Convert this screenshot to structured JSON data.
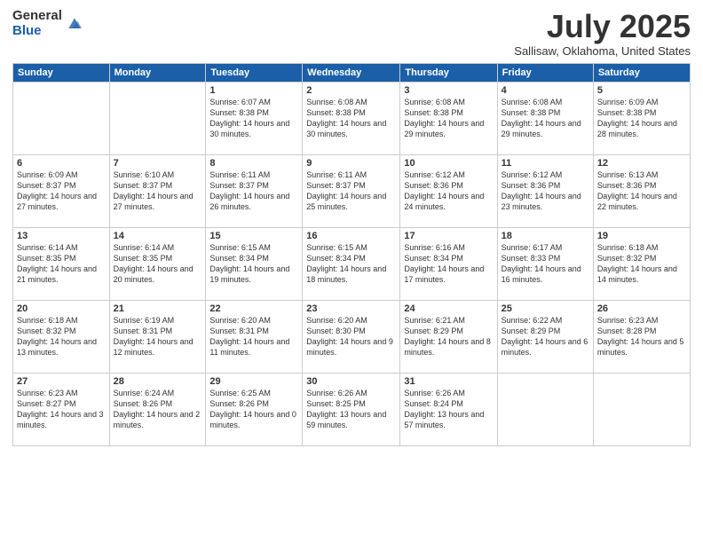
{
  "logo": {
    "general": "General",
    "blue": "Blue"
  },
  "title": "July 2025",
  "location": "Sallisaw, Oklahoma, United States",
  "headers": [
    "Sunday",
    "Monday",
    "Tuesday",
    "Wednesday",
    "Thursday",
    "Friday",
    "Saturday"
  ],
  "weeks": [
    [
      {
        "day": "",
        "sunrise": "",
        "sunset": "",
        "daylight": ""
      },
      {
        "day": "",
        "sunrise": "",
        "sunset": "",
        "daylight": ""
      },
      {
        "day": "1",
        "sunrise": "Sunrise: 6:07 AM",
        "sunset": "Sunset: 8:38 PM",
        "daylight": "Daylight: 14 hours and 30 minutes."
      },
      {
        "day": "2",
        "sunrise": "Sunrise: 6:08 AM",
        "sunset": "Sunset: 8:38 PM",
        "daylight": "Daylight: 14 hours and 30 minutes."
      },
      {
        "day": "3",
        "sunrise": "Sunrise: 6:08 AM",
        "sunset": "Sunset: 8:38 PM",
        "daylight": "Daylight: 14 hours and 29 minutes."
      },
      {
        "day": "4",
        "sunrise": "Sunrise: 6:08 AM",
        "sunset": "Sunset: 8:38 PM",
        "daylight": "Daylight: 14 hours and 29 minutes."
      },
      {
        "day": "5",
        "sunrise": "Sunrise: 6:09 AM",
        "sunset": "Sunset: 8:38 PM",
        "daylight": "Daylight: 14 hours and 28 minutes."
      }
    ],
    [
      {
        "day": "6",
        "sunrise": "Sunrise: 6:09 AM",
        "sunset": "Sunset: 8:37 PM",
        "daylight": "Daylight: 14 hours and 27 minutes."
      },
      {
        "day": "7",
        "sunrise": "Sunrise: 6:10 AM",
        "sunset": "Sunset: 8:37 PM",
        "daylight": "Daylight: 14 hours and 27 minutes."
      },
      {
        "day": "8",
        "sunrise": "Sunrise: 6:11 AM",
        "sunset": "Sunset: 8:37 PM",
        "daylight": "Daylight: 14 hours and 26 minutes."
      },
      {
        "day": "9",
        "sunrise": "Sunrise: 6:11 AM",
        "sunset": "Sunset: 8:37 PM",
        "daylight": "Daylight: 14 hours and 25 minutes."
      },
      {
        "day": "10",
        "sunrise": "Sunrise: 6:12 AM",
        "sunset": "Sunset: 8:36 PM",
        "daylight": "Daylight: 14 hours and 24 minutes."
      },
      {
        "day": "11",
        "sunrise": "Sunrise: 6:12 AM",
        "sunset": "Sunset: 8:36 PM",
        "daylight": "Daylight: 14 hours and 23 minutes."
      },
      {
        "day": "12",
        "sunrise": "Sunrise: 6:13 AM",
        "sunset": "Sunset: 8:36 PM",
        "daylight": "Daylight: 14 hours and 22 minutes."
      }
    ],
    [
      {
        "day": "13",
        "sunrise": "Sunrise: 6:14 AM",
        "sunset": "Sunset: 8:35 PM",
        "daylight": "Daylight: 14 hours and 21 minutes."
      },
      {
        "day": "14",
        "sunrise": "Sunrise: 6:14 AM",
        "sunset": "Sunset: 8:35 PM",
        "daylight": "Daylight: 14 hours and 20 minutes."
      },
      {
        "day": "15",
        "sunrise": "Sunrise: 6:15 AM",
        "sunset": "Sunset: 8:34 PM",
        "daylight": "Daylight: 14 hours and 19 minutes."
      },
      {
        "day": "16",
        "sunrise": "Sunrise: 6:15 AM",
        "sunset": "Sunset: 8:34 PM",
        "daylight": "Daylight: 14 hours and 18 minutes."
      },
      {
        "day": "17",
        "sunrise": "Sunrise: 6:16 AM",
        "sunset": "Sunset: 8:34 PM",
        "daylight": "Daylight: 14 hours and 17 minutes."
      },
      {
        "day": "18",
        "sunrise": "Sunrise: 6:17 AM",
        "sunset": "Sunset: 8:33 PM",
        "daylight": "Daylight: 14 hours and 16 minutes."
      },
      {
        "day": "19",
        "sunrise": "Sunrise: 6:18 AM",
        "sunset": "Sunset: 8:32 PM",
        "daylight": "Daylight: 14 hours and 14 minutes."
      }
    ],
    [
      {
        "day": "20",
        "sunrise": "Sunrise: 6:18 AM",
        "sunset": "Sunset: 8:32 PM",
        "daylight": "Daylight: 14 hours and 13 minutes."
      },
      {
        "day": "21",
        "sunrise": "Sunrise: 6:19 AM",
        "sunset": "Sunset: 8:31 PM",
        "daylight": "Daylight: 14 hours and 12 minutes."
      },
      {
        "day": "22",
        "sunrise": "Sunrise: 6:20 AM",
        "sunset": "Sunset: 8:31 PM",
        "daylight": "Daylight: 14 hours and 11 minutes."
      },
      {
        "day": "23",
        "sunrise": "Sunrise: 6:20 AM",
        "sunset": "Sunset: 8:30 PM",
        "daylight": "Daylight: 14 hours and 9 minutes."
      },
      {
        "day": "24",
        "sunrise": "Sunrise: 6:21 AM",
        "sunset": "Sunset: 8:29 PM",
        "daylight": "Daylight: 14 hours and 8 minutes."
      },
      {
        "day": "25",
        "sunrise": "Sunrise: 6:22 AM",
        "sunset": "Sunset: 8:29 PM",
        "daylight": "Daylight: 14 hours and 6 minutes."
      },
      {
        "day": "26",
        "sunrise": "Sunrise: 6:23 AM",
        "sunset": "Sunset: 8:28 PM",
        "daylight": "Daylight: 14 hours and 5 minutes."
      }
    ],
    [
      {
        "day": "27",
        "sunrise": "Sunrise: 6:23 AM",
        "sunset": "Sunset: 8:27 PM",
        "daylight": "Daylight: 14 hours and 3 minutes."
      },
      {
        "day": "28",
        "sunrise": "Sunrise: 6:24 AM",
        "sunset": "Sunset: 8:26 PM",
        "daylight": "Daylight: 14 hours and 2 minutes."
      },
      {
        "day": "29",
        "sunrise": "Sunrise: 6:25 AM",
        "sunset": "Sunset: 8:26 PM",
        "daylight": "Daylight: 14 hours and 0 minutes."
      },
      {
        "day": "30",
        "sunrise": "Sunrise: 6:26 AM",
        "sunset": "Sunset: 8:25 PM",
        "daylight": "Daylight: 13 hours and 59 minutes."
      },
      {
        "day": "31",
        "sunrise": "Sunrise: 6:26 AM",
        "sunset": "Sunset: 8:24 PM",
        "daylight": "Daylight: 13 hours and 57 minutes."
      },
      {
        "day": "",
        "sunrise": "",
        "sunset": "",
        "daylight": ""
      },
      {
        "day": "",
        "sunrise": "",
        "sunset": "",
        "daylight": ""
      }
    ]
  ]
}
